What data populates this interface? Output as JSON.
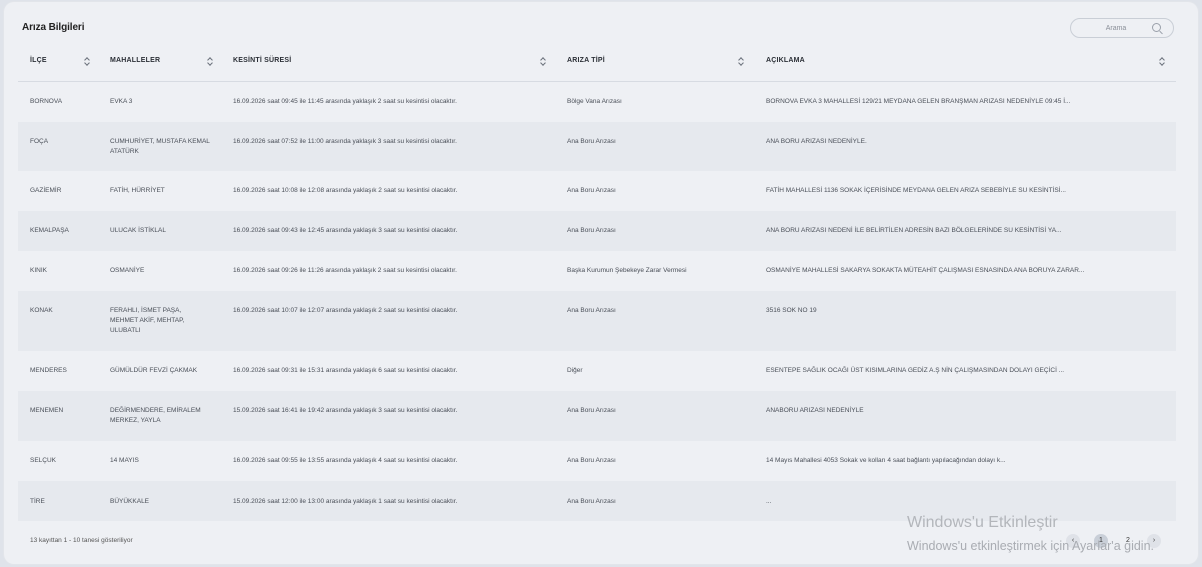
{
  "title": "Arıza Bilgileri",
  "search": {
    "placeholder": "Arama"
  },
  "columns": [
    "İLÇE",
    "MAHALLELER",
    "KESİNTİ SÜRESİ",
    "ARIZA TİPİ",
    "AÇIKLAMA"
  ],
  "rows": [
    {
      "ilce": "BORNOVA",
      "mahalleler": "EVKA 3",
      "kesinti": "16.09.2026 saat 09:45 ile 11:45 arasında yaklaşık 2 saat su kesintisi olacaktır.",
      "tip": "Bölge Vana Arızası",
      "aciklama": "BORNOVA EVKA 3 MAHALLESİ 129/21 MEYDANA GELEN BRANŞMAN ARIZASI NEDENİYLE 09:45 İ..."
    },
    {
      "ilce": "FOÇA",
      "mahalleler": "CUMHURİYET, MUSTAFA KEMAL ATATÜRK",
      "kesinti": "16.09.2026 saat 07:52 ile 11:00 arasında yaklaşık 3 saat su kesintisi olacaktır.",
      "tip": "Ana Boru Arızası",
      "aciklama": "ANA BORU ARIZASI NEDENİYLE."
    },
    {
      "ilce": "GAZİEMİR",
      "mahalleler": "FATİH, HÜRRİYET",
      "kesinti": "16.09.2026 saat 10:08 ile 12:08 arasında yaklaşık 2 saat su kesintisi olacaktır.",
      "tip": "Ana Boru Arızası",
      "aciklama": "FATİH MAHALLESİ 1136 SOKAK İÇERİSİNDE MEYDANA GELEN ARIZA SEBEBİYLE SU KESİNTİSİ..."
    },
    {
      "ilce": "KEMALPAŞA",
      "mahalleler": "ULUCAK İSTİKLAL",
      "kesinti": "16.09.2026 saat 09:43 ile 12:45 arasında yaklaşık 3 saat su kesintisi olacaktır.",
      "tip": "Ana Boru Arızası",
      "aciklama": "ANA BORU ARIZASI NEDENİ İLE BELİRTİLEN ADRESİN BAZI BÖLGELERİNDE SU KESİNTİSİ YA..."
    },
    {
      "ilce": "KINIK",
      "mahalleler": "OSMANİYE",
      "kesinti": "16.09.2026 saat 09:26 ile 11:26 arasında yaklaşık 2 saat su kesintisi olacaktır.",
      "tip": "Başka Kurumun Şebekeye Zarar Vermesi",
      "aciklama": "OSMANİYE MAHALLESİ SAKARYA SOKAKTA MÜTEAHİT ÇALIŞMASI ESNASINDA ANA BORUYA ZARAR..."
    },
    {
      "ilce": "KONAK",
      "mahalleler": "FERAHLI, İSMET PAŞA, MEHMET AKİF, MEHTAP, ULUBATLI",
      "kesinti": "16.09.2026 saat 10:07 ile 12:07 arasında yaklaşık 2 saat su kesintisi olacaktır.",
      "tip": "Ana Boru Arızası",
      "aciklama": "3516 SOK NO 19"
    },
    {
      "ilce": "MENDERES",
      "mahalleler": "GÜMÜLDÜR FEVZİ ÇAKMAK",
      "kesinti": "16.09.2026 saat 09:31 ile 15:31 arasında yaklaşık 6 saat su kesintisi olacaktır.",
      "tip": "Diğer",
      "aciklama": "ESENTEPE SAĞLIK OCAĞI ÜST KISIMLARINA GEDİZ A.Ş NİN ÇALIŞMASINDAN DOLAYI GEÇİCİ ..."
    },
    {
      "ilce": "MENEMEN",
      "mahalleler": "DEĞİRMENDERE, EMİRALEM MERKEZ, YAYLA",
      "kesinti": "15.09.2026 saat 16:41 ile 19:42 arasında yaklaşık 3 saat su kesintisi olacaktır.",
      "tip": "Ana Boru Arızası",
      "aciklama": "ANABORU ARIZASI NEDENİYLE"
    },
    {
      "ilce": "SELÇUK",
      "mahalleler": "14 MAYIS",
      "kesinti": "16.09.2026 saat 09:55 ile 13:55 arasında yaklaşık 4 saat su kesintisi olacaktır.",
      "tip": "Ana Boru Arızası",
      "aciklama": "14 Mayıs Mahallesi 4053 Sokak ve kolları 4 saat bağlantı yapılacağından dolayı k..."
    },
    {
      "ilce": "TİRE",
      "mahalleler": "BÜYÜKKALE",
      "kesinti": "15.09.2026 saat 12:00 ile 13:00 arasında yaklaşık 1 saat su kesintisi olacaktır.",
      "tip": "Ana Boru Arızası",
      "aciklama": "..."
    }
  ],
  "footer": "13 kayıttan 1 - 10 tanesi gösteriliyor",
  "pagination": {
    "prev": "‹",
    "pages": [
      "1",
      "2"
    ],
    "next": "›",
    "active": "1"
  },
  "watermark": {
    "line1": "Windows'u Etkinleştir",
    "line2": "Windows'u etkinleştirmek için Ayarlar'a gidin."
  }
}
